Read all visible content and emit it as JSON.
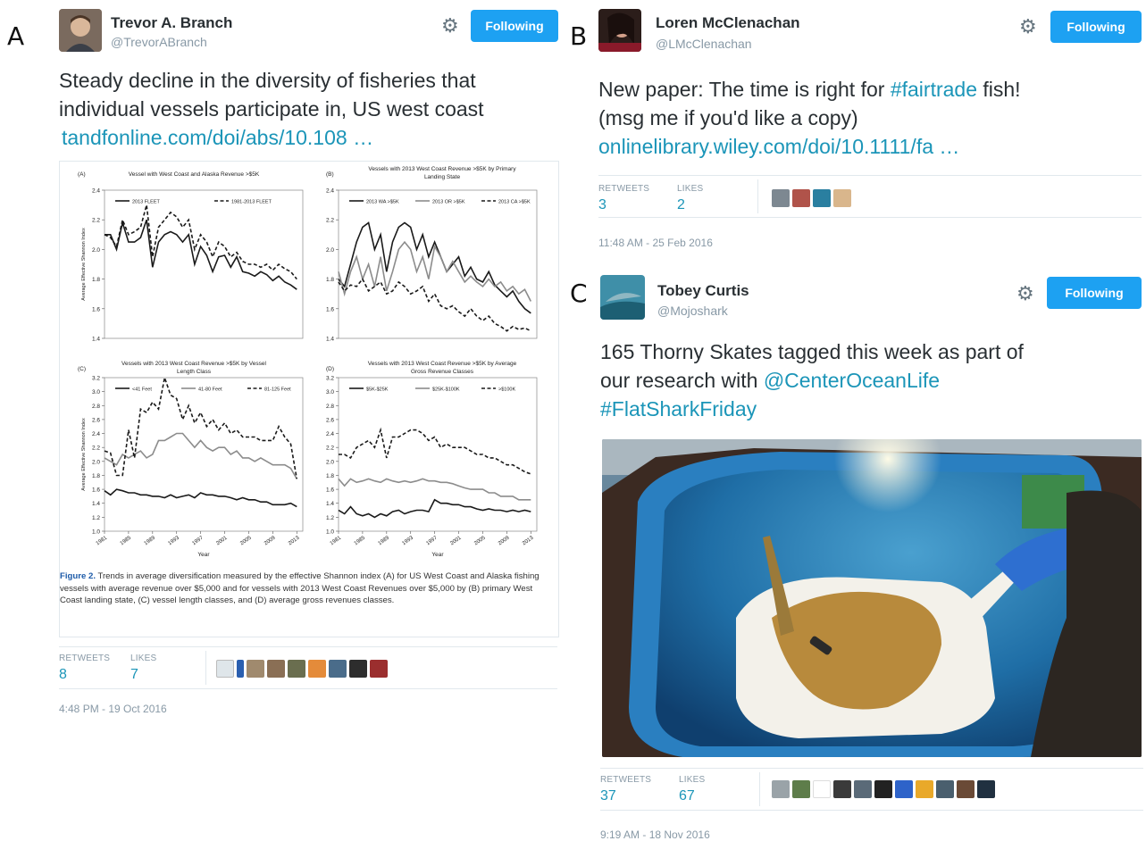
{
  "panels": [
    "A",
    "B",
    "C"
  ],
  "colors": {
    "follow": "#1da1f2",
    "link": "#1b95b8",
    "muted": "#8899a6"
  },
  "tweetA": {
    "name": "Trevor A. Branch",
    "handle": "@TrevorABranch",
    "follow_label": "Following",
    "text_lines": [
      "Steady decline in the diversity of fisheries that",
      "individual vessels participate in, US west coast"
    ],
    "link": "tandfonline.com/doi/abs/10.108 …",
    "retweets_label": "RETWEETS",
    "retweets": "8",
    "likes_label": "LIKES",
    "likes": "7",
    "timestamp": "4:48 PM - 19 Oct 2016",
    "figure": {
      "caption_title": "Figure 2.",
      "caption_body": " Trends in average diversification measured by the effective Shannon index (A) for US West Coast and Alaska fishing vessels with average revenue over $5,000 and for vessels with 2013 West Coast Revenues over $5,000 by (B) primary West Coast landing state, (C) vessel length classes, and (D) average gross revenues classes."
    }
  },
  "tweetB": {
    "name": "Loren McClenachan",
    "handle": "@LMcClenachan",
    "follow_label": "Following",
    "text_pre": "New paper: The time is right for ",
    "hashtag": "#fairtrade",
    "text_post": " fish!",
    "text_line2": "(msg me if you'd like a copy)",
    "link": "onlinelibrary.wiley.com/doi/10.1111/fa …",
    "retweets_label": "RETWEETS",
    "retweets": "3",
    "likes_label": "LIKES",
    "likes": "2",
    "timestamp": "11:48 AM - 25 Feb 2016"
  },
  "tweetC": {
    "name": "Tobey Curtis",
    "handle": "@Mojoshark",
    "follow_label": "Following",
    "text_line1": "165 Thorny Skates tagged this week as part of",
    "text_pre2": "our research with ",
    "mention": "@CenterOceanLife",
    "hashtag": "#FlatSharkFriday",
    "retweets_label": "RETWEETS",
    "retweets": "37",
    "likes_label": "LIKES",
    "likes": "67",
    "timestamp": "9:19 AM - 18 Nov 2016"
  },
  "chart_data": [
    {
      "type": "line",
      "panel": "(A)",
      "title": "Vessel with West Coast and Alaska Revenue >$5K",
      "ylabel": "Average Effective Shannon Index",
      "xlabel": "",
      "ylim": [
        1.4,
        2.4
      ],
      "yticks": [
        1.4,
        1.6,
        1.8,
        2.0,
        2.2,
        2.4
      ],
      "xlim": [
        1981,
        2014
      ],
      "x": [
        1981,
        1982,
        1983,
        1984,
        1985,
        1986,
        1987,
        1988,
        1989,
        1990,
        1991,
        1992,
        1993,
        1994,
        1995,
        1996,
        1997,
        1998,
        1999,
        2000,
        2001,
        2002,
        2003,
        2004,
        2005,
        2006,
        2007,
        2008,
        2009,
        2010,
        2011,
        2012,
        2013
      ],
      "series": [
        {
          "name": "2013 FLEET",
          "style": "solid-dark",
          "values": [
            2.1,
            2.1,
            2.0,
            2.18,
            2.05,
            2.05,
            2.08,
            2.2,
            1.88,
            2.05,
            2.1,
            2.12,
            2.1,
            2.05,
            2.1,
            1.9,
            2.02,
            1.96,
            1.85,
            1.95,
            1.96,
            1.88,
            1.95,
            1.85,
            1.84,
            1.82,
            1.85,
            1.83,
            1.79,
            1.82,
            1.78,
            1.76,
            1.73
          ]
        },
        {
          "name": "1981-2013 FLEET",
          "style": "dashed-dark",
          "values": [
            2.1,
            2.08,
            2.02,
            2.2,
            2.1,
            2.12,
            2.15,
            2.3,
            1.95,
            2.15,
            2.2,
            2.25,
            2.22,
            2.15,
            2.2,
            2.0,
            2.1,
            2.05,
            1.95,
            2.05,
            2.02,
            1.95,
            1.98,
            1.92,
            1.9,
            1.9,
            1.88,
            1.9,
            1.86,
            1.9,
            1.87,
            1.85,
            1.8
          ]
        }
      ]
    },
    {
      "type": "line",
      "panel": "(B)",
      "title": "Vessels with 2013 West Coast Revenue >$5K by Primary Landing State",
      "ylim": [
        1.4,
        2.4
      ],
      "yticks": [
        1.4,
        1.6,
        1.8,
        2.0,
        2.2,
        2.4
      ],
      "xlim": [
        1981,
        2014
      ],
      "x": [
        1981,
        1982,
        1983,
        1984,
        1985,
        1986,
        1987,
        1988,
        1989,
        1990,
        1991,
        1992,
        1993,
        1994,
        1995,
        1996,
        1997,
        1998,
        1999,
        2000,
        2001,
        2002,
        2003,
        2004,
        2005,
        2006,
        2007,
        2008,
        2009,
        2010,
        2011,
        2012,
        2013
      ],
      "series": [
        {
          "name": "2013 WA >$5K",
          "style": "solid-dark",
          "values": [
            1.8,
            1.75,
            1.9,
            2.05,
            2.15,
            2.18,
            2.0,
            2.1,
            1.85,
            2.05,
            2.15,
            2.18,
            2.15,
            2.0,
            2.1,
            1.95,
            2.05,
            1.95,
            1.85,
            1.9,
            1.95,
            1.82,
            1.88,
            1.8,
            1.78,
            1.85,
            1.76,
            1.72,
            1.68,
            1.72,
            1.65,
            1.6,
            1.57
          ]
        },
        {
          "name": "2013 OR >$5K",
          "style": "solid-gray",
          "values": [
            1.85,
            1.7,
            1.85,
            1.95,
            1.8,
            1.9,
            1.75,
            1.95,
            1.72,
            1.85,
            2.0,
            2.05,
            2.0,
            1.85,
            1.95,
            1.8,
            2.02,
            1.95,
            1.85,
            1.92,
            1.85,
            1.78,
            1.82,
            1.78,
            1.75,
            1.8,
            1.75,
            1.78,
            1.72,
            1.75,
            1.7,
            1.73,
            1.65
          ]
        },
        {
          "name": "2013 CA >$5K",
          "style": "dashed-dark",
          "values": [
            1.78,
            1.72,
            1.76,
            1.75,
            1.8,
            1.72,
            1.75,
            1.78,
            1.7,
            1.72,
            1.78,
            1.75,
            1.7,
            1.72,
            1.75,
            1.65,
            1.7,
            1.62,
            1.6,
            1.62,
            1.58,
            1.55,
            1.6,
            1.55,
            1.52,
            1.55,
            1.5,
            1.48,
            1.45,
            1.48,
            1.46,
            1.47,
            1.45
          ]
        }
      ]
    },
    {
      "type": "line",
      "panel": "(C)",
      "title": "Vessels with 2013 West Coast Revenue >$5K by Vessel Length Class",
      "ylabel": "Average Effective Shannon Index",
      "xlabel": "Year",
      "ylim": [
        1.0,
        3.2
      ],
      "yticks": [
        1.0,
        1.2,
        1.4,
        1.6,
        1.8,
        2.0,
        2.2,
        2.4,
        2.6,
        2.8,
        3.0,
        3.2
      ],
      "xlim": [
        1981,
        2014
      ],
      "xticks": [
        1981,
        1985,
        1989,
        1993,
        1997,
        2001,
        2005,
        2009,
        2013
      ],
      "x": [
        1981,
        1982,
        1983,
        1984,
        1985,
        1986,
        1987,
        1988,
        1989,
        1990,
        1991,
        1992,
        1993,
        1994,
        1995,
        1996,
        1997,
        1998,
        1999,
        2000,
        2001,
        2002,
        2003,
        2004,
        2005,
        2006,
        2007,
        2008,
        2009,
        2010,
        2011,
        2012,
        2013
      ],
      "series": [
        {
          "name": "<41 Feet",
          "style": "solid-dark",
          "values": [
            1.58,
            1.52,
            1.6,
            1.58,
            1.55,
            1.55,
            1.52,
            1.52,
            1.5,
            1.5,
            1.48,
            1.52,
            1.48,
            1.5,
            1.52,
            1.48,
            1.55,
            1.52,
            1.52,
            1.5,
            1.5,
            1.48,
            1.45,
            1.48,
            1.45,
            1.45,
            1.42,
            1.42,
            1.38,
            1.38,
            1.38,
            1.4,
            1.35
          ]
        },
        {
          "name": "41-80 Feet",
          "style": "solid-gray",
          "values": [
            2.05,
            2.0,
            1.95,
            2.1,
            2.05,
            2.1,
            2.15,
            2.05,
            2.1,
            2.3,
            2.3,
            2.35,
            2.4,
            2.4,
            2.3,
            2.2,
            2.3,
            2.2,
            2.15,
            2.2,
            2.2,
            2.1,
            2.15,
            2.05,
            2.05,
            2.0,
            2.05,
            2.0,
            1.95,
            1.95,
            1.95,
            1.9,
            1.75
          ]
        },
        {
          "name": "81-125 Feet",
          "style": "dashed-dark",
          "values": [
            2.15,
            2.12,
            1.8,
            1.8,
            2.45,
            2.05,
            2.75,
            2.7,
            2.85,
            2.75,
            3.2,
            2.95,
            2.9,
            2.6,
            2.8,
            2.55,
            2.7,
            2.5,
            2.6,
            2.45,
            2.55,
            2.4,
            2.45,
            2.35,
            2.35,
            2.35,
            2.3,
            2.3,
            2.3,
            2.5,
            2.35,
            2.25,
            1.75
          ]
        }
      ]
    },
    {
      "type": "line",
      "panel": "(D)",
      "title": "Vessels with 2013 West Coast Revenue >$5K by Average Gross Revenue Classes",
      "xlabel": "Year",
      "ylim": [
        1.0,
        3.2
      ],
      "yticks": [
        1.0,
        1.2,
        1.4,
        1.6,
        1.8,
        2.0,
        2.2,
        2.4,
        2.6,
        2.8,
        3.0,
        3.2
      ],
      "xlim": [
        1981,
        2014
      ],
      "xticks": [
        1981,
        1985,
        1989,
        1993,
        1997,
        2001,
        2005,
        2009,
        2013
      ],
      "x": [
        1981,
        1982,
        1983,
        1984,
        1985,
        1986,
        1987,
        1988,
        1989,
        1990,
        1991,
        1992,
        1993,
        1994,
        1995,
        1996,
        1997,
        1998,
        1999,
        2000,
        2001,
        2002,
        2003,
        2004,
        2005,
        2006,
        2007,
        2008,
        2009,
        2010,
        2011,
        2012,
        2013
      ],
      "series": [
        {
          "name": "$5K-$25K",
          "style": "solid-dark",
          "values": [
            1.3,
            1.25,
            1.35,
            1.25,
            1.22,
            1.25,
            1.2,
            1.25,
            1.22,
            1.28,
            1.3,
            1.25,
            1.28,
            1.3,
            1.3,
            1.28,
            1.45,
            1.4,
            1.4,
            1.38,
            1.38,
            1.35,
            1.35,
            1.32,
            1.3,
            1.32,
            1.3,
            1.3,
            1.28,
            1.3,
            1.28,
            1.3,
            1.28
          ]
        },
        {
          "name": "$25K-$100K",
          "style": "solid-gray",
          "values": [
            1.75,
            1.65,
            1.75,
            1.7,
            1.72,
            1.75,
            1.72,
            1.7,
            1.75,
            1.72,
            1.7,
            1.72,
            1.7,
            1.72,
            1.75,
            1.72,
            1.72,
            1.7,
            1.7,
            1.68,
            1.65,
            1.62,
            1.6,
            1.6,
            1.6,
            1.55,
            1.55,
            1.5,
            1.5,
            1.5,
            1.45,
            1.45,
            1.45
          ]
        },
        {
          "name": ">$100K",
          "style": "dashed-dark",
          "values": [
            2.1,
            2.1,
            2.05,
            2.2,
            2.25,
            2.3,
            2.2,
            2.45,
            2.05,
            2.35,
            2.35,
            2.4,
            2.45,
            2.45,
            2.4,
            2.3,
            2.35,
            2.2,
            2.25,
            2.2,
            2.2,
            2.2,
            2.15,
            2.1,
            2.1,
            2.05,
            2.05,
            2.0,
            1.95,
            1.95,
            1.9,
            1.85,
            1.82
          ]
        }
      ]
    }
  ]
}
